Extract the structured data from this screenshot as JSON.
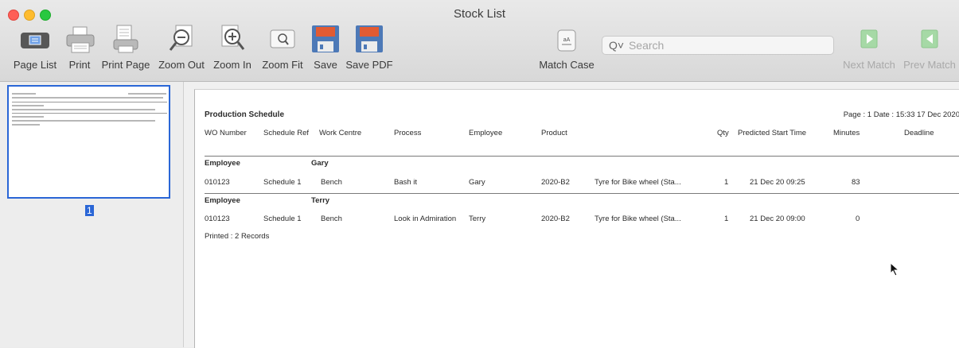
{
  "window": {
    "title": "Stock List"
  },
  "toolbar": {
    "page_list": "Page List",
    "print": "Print",
    "print_page": "Print Page",
    "zoom_out": "Zoom Out",
    "zoom_in": "Zoom In",
    "zoom_fit": "Zoom Fit",
    "save": "Save",
    "save_pdf": "Save PDF",
    "match_case": "Match Case",
    "next_match": "Next Match",
    "prev_match": "Prev Match"
  },
  "search": {
    "placeholder": "Search",
    "icon": "magnifier-icon"
  },
  "sidebar": {
    "page_number": "1"
  },
  "report": {
    "title": "Production Schedule",
    "page_info": "Page : 1  Date : 15:33  17 Dec 2020",
    "columns": [
      "WO Number",
      "Schedule Ref",
      "Work Centre",
      "Process",
      "Employee",
      "Product",
      "Qty",
      "Predicted Start Time",
      "Minutes",
      "Deadline"
    ],
    "groups": [
      {
        "label": "Employee",
        "name": "Gary",
        "rows": [
          {
            "wo": "010123",
            "schedule": "Schedule 1",
            "centre": "Bench",
            "process": "Bash it",
            "employee": "Gary",
            "product": "2020-B2",
            "description": "Tyre for Bike wheel (Sta...",
            "qty": "1",
            "start": "21 Dec 20  09:25",
            "minutes": "83",
            "deadline": ""
          }
        ]
      },
      {
        "label": "Employee",
        "name": "Terry",
        "rows": [
          {
            "wo": "010123",
            "schedule": "Schedule 1",
            "centre": "Bench",
            "process": "Look in Admiration",
            "employee": "Terry",
            "product": "2020-B2",
            "description": "Tyre for Bike wheel (Sta...",
            "qty": "1",
            "start": "21 Dec 20  09:00",
            "minutes": "0",
            "deadline": ""
          }
        ]
      }
    ],
    "footer": "Printed : 2 Records"
  }
}
